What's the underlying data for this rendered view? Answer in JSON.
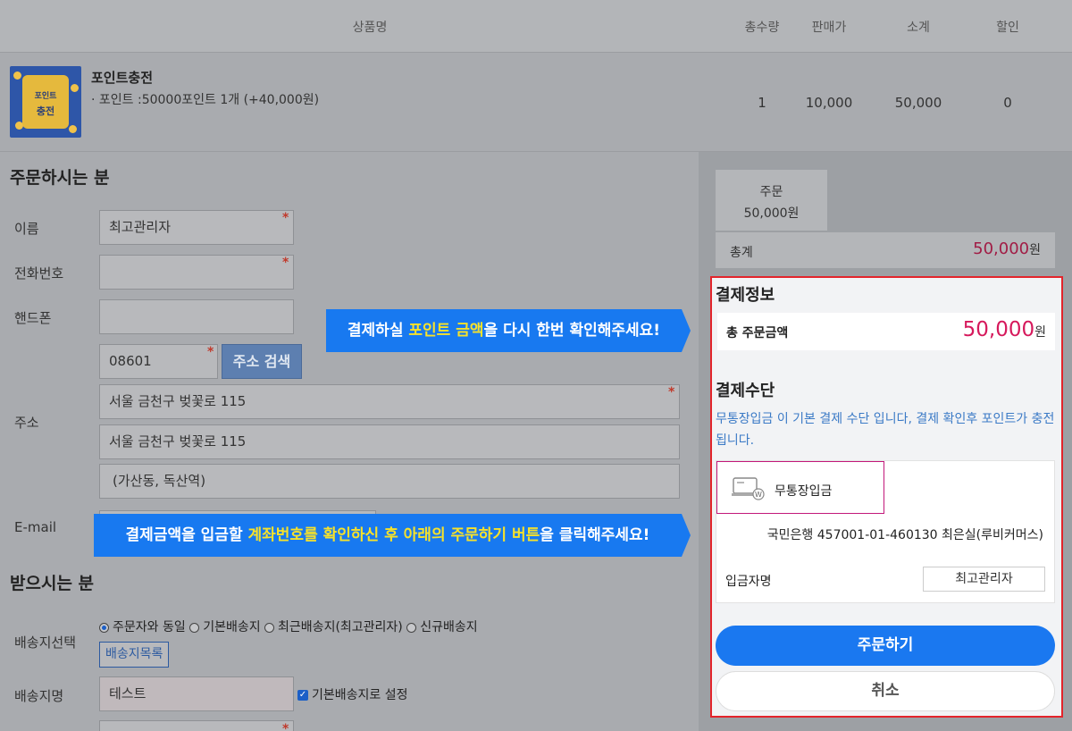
{
  "table_header": {
    "product": "상품명",
    "qty": "총수량",
    "price": "판매가",
    "subtotal": "소계",
    "discount": "할인"
  },
  "product": {
    "thumb_small": "포인트",
    "thumb_big": "충전",
    "name": "포인트충전",
    "option": "· 포인트 :50000포인트 1개 (+40,000원)",
    "qty": "1",
    "price": "10,000",
    "subtotal": "50,000",
    "discount": "0"
  },
  "orderer": {
    "title": "주문하시는 분",
    "name_label": "이름",
    "name_value": "최고관리자",
    "phone_label": "전화번호",
    "phone_value": "",
    "mobile_label": "핸드폰",
    "mobile_value": "",
    "zip_value": "08601",
    "address_search_button": "주소 검색",
    "address_label": "주소",
    "address1": "서울 금천구 벚꽃로 115",
    "address2": "서울 금천구 벚꽃로 115",
    "address3": "(가산동, 독산역)",
    "email_label": "E-mail",
    "required_mark": "*"
  },
  "receiver": {
    "title": "받으시는 분",
    "dest_select_label": "배송지선택",
    "options": [
      "주문자와 동일",
      "기본배송지",
      "최근배송지(최고관리자)",
      "신규배송지"
    ],
    "selected_option": "주문자와 동일",
    "dest_list_button": "배송지목록",
    "dest_name_label": "배송지명",
    "dest_name_value": "테스트",
    "default_dest_checkbox": "기본배송지로 설정",
    "default_dest_checked": true
  },
  "callouts": {
    "top_pre": "결제하실 ",
    "top_hl": "포인트 금액",
    "top_post": "을 다시 한번 확인해주세요!",
    "bottom_pre": "결제금액을 입금할 ",
    "bottom_hl": "계좌번호를 확인하신 후 아래의 주문하기 버튼",
    "bottom_post": "을 클릭해주세요!"
  },
  "summary": {
    "order_label": "주문",
    "order_amount": "50,000원",
    "total_label": "총계",
    "total_amount": "50,000",
    "total_unit": "원"
  },
  "payment": {
    "info_title": "결제정보",
    "total_order_label": "총 주문금액",
    "total_order_amount": "50,000",
    "currency_unit": "원",
    "method_title": "결제수단",
    "notice": "무통장입금 이 기본 결제 수단 입니다, 결제 확인후 포인트가 충전됩니다.",
    "method_name": "무통장입금",
    "bank_account": "국민은행 457001-01-460130 최은실(루비커머스)",
    "depositor_label": "입금자명",
    "depositor_value": "최고관리자",
    "order_button": "주문하기",
    "cancel_button": "취소"
  },
  "colors": {
    "accent_blue": "#1879f0",
    "highlight_yellow": "#f7e22a",
    "price_pink": "#d6195c",
    "border_red": "#e3242b"
  }
}
